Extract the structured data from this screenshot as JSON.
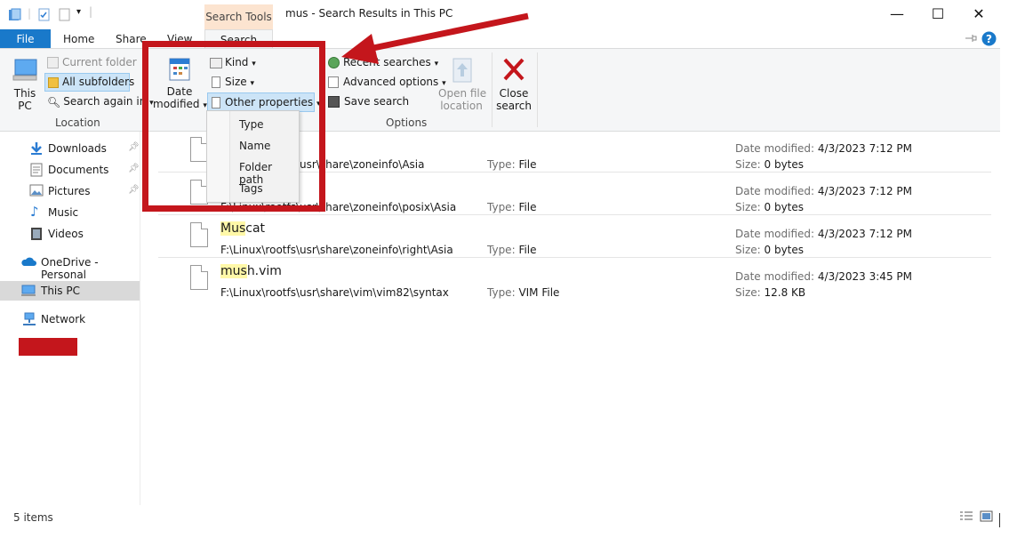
{
  "title_bar": {
    "context_tab": "Search Tools",
    "window_title": "mus - Search Results in This PC",
    "minimize_icon": "minimize-icon",
    "maximize_icon": "maximize-icon",
    "close_icon": "close-icon"
  },
  "tabs": {
    "file": "File",
    "home": "Home",
    "share": "Share",
    "view": "View",
    "search": "Search"
  },
  "ribbon": {
    "location": {
      "this_pc_line1": "This",
      "this_pc_line2": "PC",
      "current_folder": "Current folder",
      "all_subfolders": "All subfolders",
      "search_again_in": "Search again in",
      "group_label": "Location"
    },
    "refine": {
      "date_modified_line1": "Date",
      "date_modified_line2": "modified",
      "kind": "Kind",
      "size": "Size",
      "other_properties": "Other properties"
    },
    "options": {
      "recent_searches": "Recent searches",
      "advanced_options": "Advanced options",
      "save_search": "Save search",
      "open_file_location_line1": "Open file",
      "open_file_location_line2": "location",
      "group_label": "Options"
    },
    "close_search_line1": "Close",
    "close_search_line2": "search"
  },
  "other_properties_menu": [
    "Type",
    "Name",
    "Folder path",
    "Tags"
  ],
  "nav_pane": {
    "items": [
      {
        "label": "Downloads",
        "icon": "download-icon",
        "pinned": true
      },
      {
        "label": "Documents",
        "icon": "document-icon",
        "pinned": true
      },
      {
        "label": "Pictures",
        "icon": "picture-icon",
        "pinned": true
      },
      {
        "label": "Music",
        "icon": "music-icon",
        "pinned": false
      },
      {
        "label": "Videos",
        "icon": "video-icon",
        "pinned": false
      },
      {
        "label": "OneDrive - Personal",
        "icon": "cloud-icon",
        "pinned": false
      },
      {
        "label": "This PC",
        "icon": "computer-icon",
        "pinned": false,
        "selected": true
      },
      {
        "label": "Network",
        "icon": "network-icon",
        "pinned": false
      }
    ]
  },
  "results": [
    {
      "name_hl": "",
      "name_rest": "",
      "path": "F:\\Linux\\rootfs\\usr\\share\\zoneinfo\\Asia",
      "type_label": "Type:",
      "type": "File",
      "date_label": "Date modified:",
      "date": "4/3/2023 7:12 PM",
      "size_label": "Size:",
      "size": "0 bytes"
    },
    {
      "name_hl": "",
      "name_rest": "",
      "path": "F:\\Linux\\rootfs\\usr\\share\\zoneinfo\\posix\\Asia",
      "type_label": "Type:",
      "type": "File",
      "date_label": "Date modified:",
      "date": "4/3/2023 7:12 PM",
      "size_label": "Size:",
      "size": "0 bytes"
    },
    {
      "name_hl": "Mus",
      "name_rest": "cat",
      "path": "F:\\Linux\\rootfs\\usr\\share\\zoneinfo\\right\\Asia",
      "type_label": "Type:",
      "type": "File",
      "date_label": "Date modified:",
      "date": "4/3/2023 7:12 PM",
      "size_label": "Size:",
      "size": "0 bytes"
    },
    {
      "name_hl": "mus",
      "name_rest": "h.vim",
      "path": "F:\\Linux\\rootfs\\usr\\share\\vim\\vim82\\syntax",
      "type_label": "Type:",
      "type": "VIM File",
      "date_label": "Date modified:",
      "date": "4/3/2023 3:45 PM",
      "size_label": "Size:",
      "size": "12.8 KB"
    }
  ],
  "status_bar": {
    "item_count": "5 items"
  },
  "colors": {
    "file_tab": "#1979ca",
    "annotation_red": "#c4161c",
    "highlight": "#fff8a8",
    "context_tab": "#fce4d0"
  }
}
